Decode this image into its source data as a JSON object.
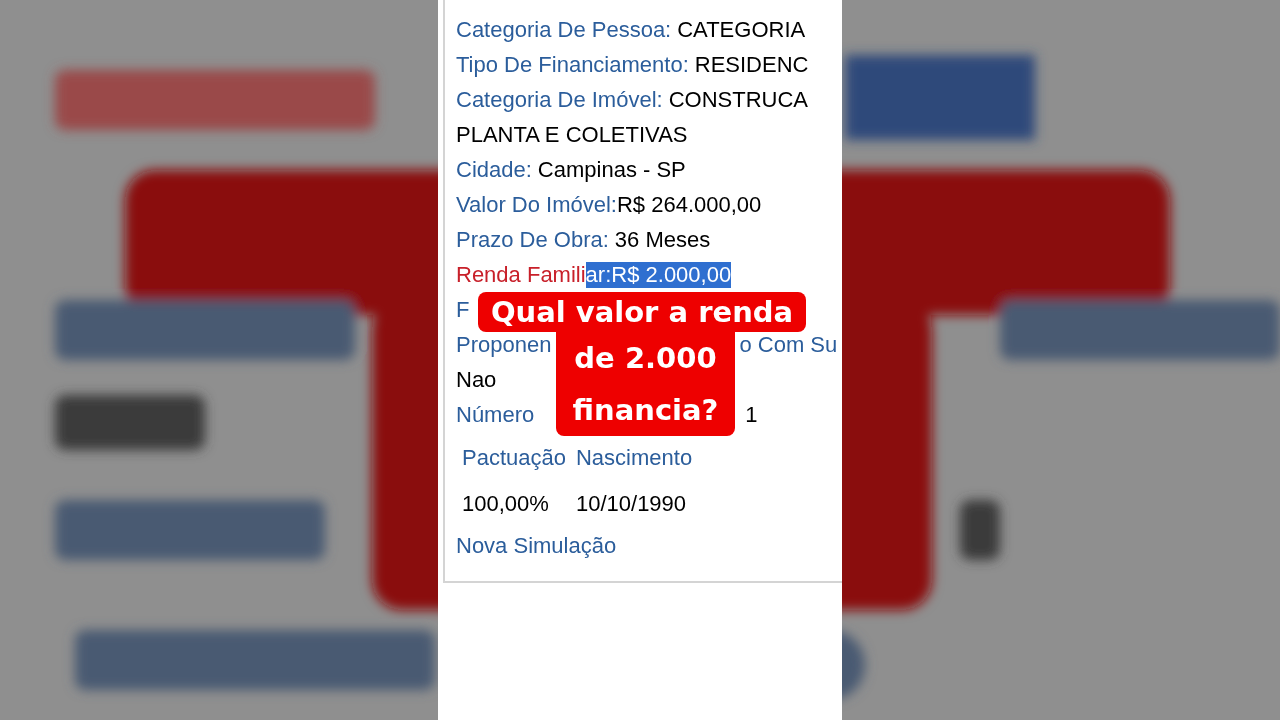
{
  "details": [
    {
      "segments": [
        {
          "kind": "label",
          "text": "Categoria De Pessoa:"
        },
        {
          "kind": "value",
          "text": "CATEGORIA"
        }
      ]
    },
    {
      "segments": [
        {
          "kind": "label",
          "text": "Tipo De Financiamento:"
        },
        {
          "kind": "value",
          "text": "RESIDENC"
        }
      ]
    },
    {
      "segments": [
        {
          "kind": "label",
          "text": "Categoria De Imóvel:"
        },
        {
          "kind": "value",
          "text": "CONSTRUCA"
        }
      ]
    },
    {
      "segments": [
        {
          "kind": "value",
          "text": "PLANTA E COLETIVAS"
        }
      ]
    },
    {
      "segments": [
        {
          "kind": "label",
          "text": "Cidade:"
        },
        {
          "kind": "value",
          "text": "Campinas - SP"
        }
      ]
    },
    {
      "segments": [
        {
          "kind": "label",
          "text": "Valor Do Imóvel:"
        },
        {
          "kind": "value",
          "text": "R$ 264.000,00"
        }
      ]
    },
    {
      "segments": [
        {
          "kind": "label",
          "text": "Prazo De Obra:"
        },
        {
          "kind": "value",
          "text": "36 Meses"
        }
      ]
    },
    {
      "segments": [
        {
          "kind": "alert",
          "text": "Renda Famili",
          "highlighted": false
        },
        {
          "kind": "alert",
          "text": "ar:",
          "highlighted": true
        },
        {
          "kind": "value",
          "text": "R$ 2.000,00",
          "highlighted": true
        }
      ]
    },
    {
      "segments": [
        {
          "kind": "label",
          "text": "F"
        }
      ]
    },
    {
      "segments": [
        {
          "kind": "label",
          "text": "Proponen"
        },
        {
          "kind": "gap"
        },
        {
          "kind": "label",
          "text": "o Com Su"
        }
      ]
    },
    {
      "segments": [
        {
          "kind": "value",
          "text": "Nao"
        }
      ]
    },
    {
      "segments": [
        {
          "kind": "label",
          "text": "Número"
        },
        {
          "kind": "gap"
        },
        {
          "kind": "value",
          "text": "1"
        }
      ]
    }
  ],
  "table": {
    "columns": [
      "Pactuação",
      "Nascimento"
    ],
    "rows": [
      [
        "100,00%",
        "10/10/1990"
      ]
    ]
  },
  "link": "Nova Simulação",
  "caption": [
    "Qual valor a renda",
    "de 2.000",
    "financia?"
  ]
}
